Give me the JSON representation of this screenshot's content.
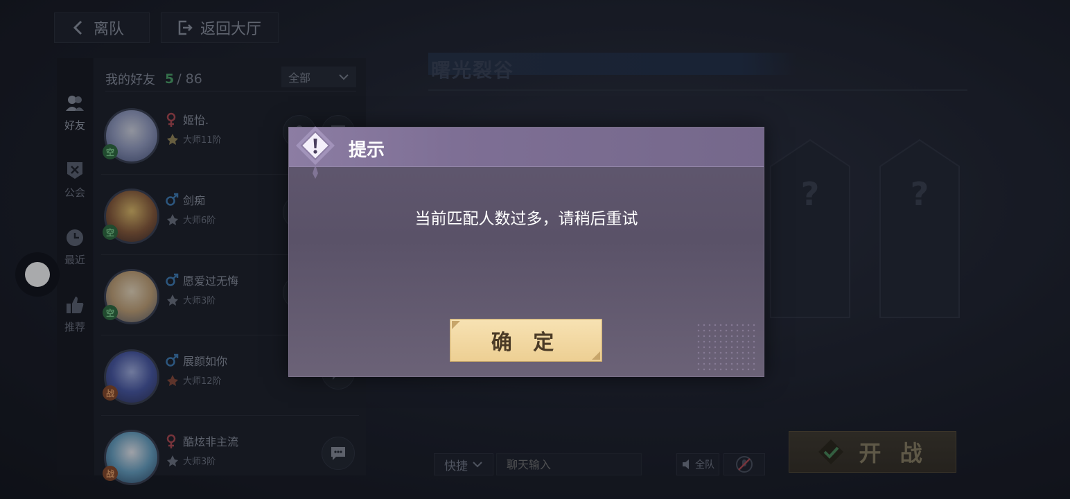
{
  "top_bar": {
    "leave_team_label": "离队",
    "back_to_lobby_label": "返回大厅"
  },
  "side_tabs": [
    {
      "label": "好友",
      "icon": "friends-icon",
      "active": true
    },
    {
      "label": "公会",
      "icon": "guild-icon",
      "active": false
    },
    {
      "label": "最近",
      "icon": "clock-icon",
      "active": false
    },
    {
      "label": "推荐",
      "icon": "thumbs-up-icon",
      "active": false
    }
  ],
  "friends": {
    "title": "我的好友",
    "online": "5",
    "total": "/ 86",
    "filter_label": "全部",
    "list": [
      {
        "name": "姬怡.",
        "rank": "大师11阶",
        "gender": "female",
        "status": "空",
        "status_color": "#2f6d3f"
      },
      {
        "name": "剑痴",
        "rank": "大师6阶",
        "gender": "male",
        "status": "空",
        "status_color": "#2f6d3f"
      },
      {
        "name": "愿爱过无悔",
        "rank": "大师3阶",
        "gender": "male",
        "status": "空",
        "status_color": "#2f6d3f"
      },
      {
        "name": "展颜如你",
        "rank": "大师12阶",
        "gender": "male",
        "status": "战",
        "status_color": "#8a4a2a"
      },
      {
        "name": "酷炫非主流",
        "rank": "大师3阶",
        "gender": "female",
        "status": "战",
        "status_color": "#8a4a2a"
      }
    ]
  },
  "map": {
    "title": "曙光裂谷",
    "slot_placeholder": "?"
  },
  "bottom_bar": {
    "quick_label": "快捷",
    "chat_placeholder": "聊天输入",
    "mute_all_label": "全队",
    "start_label": "开 战"
  },
  "dialog": {
    "title": "提示",
    "message": "当前匹配人数过多，请稍后重试",
    "confirm_label": "确 定"
  },
  "colors": {
    "online_green": "#4ea66a",
    "male_blue": "#3f7fb8",
    "female_red": "#b24a52",
    "confirm_gold": "#edcf93"
  }
}
